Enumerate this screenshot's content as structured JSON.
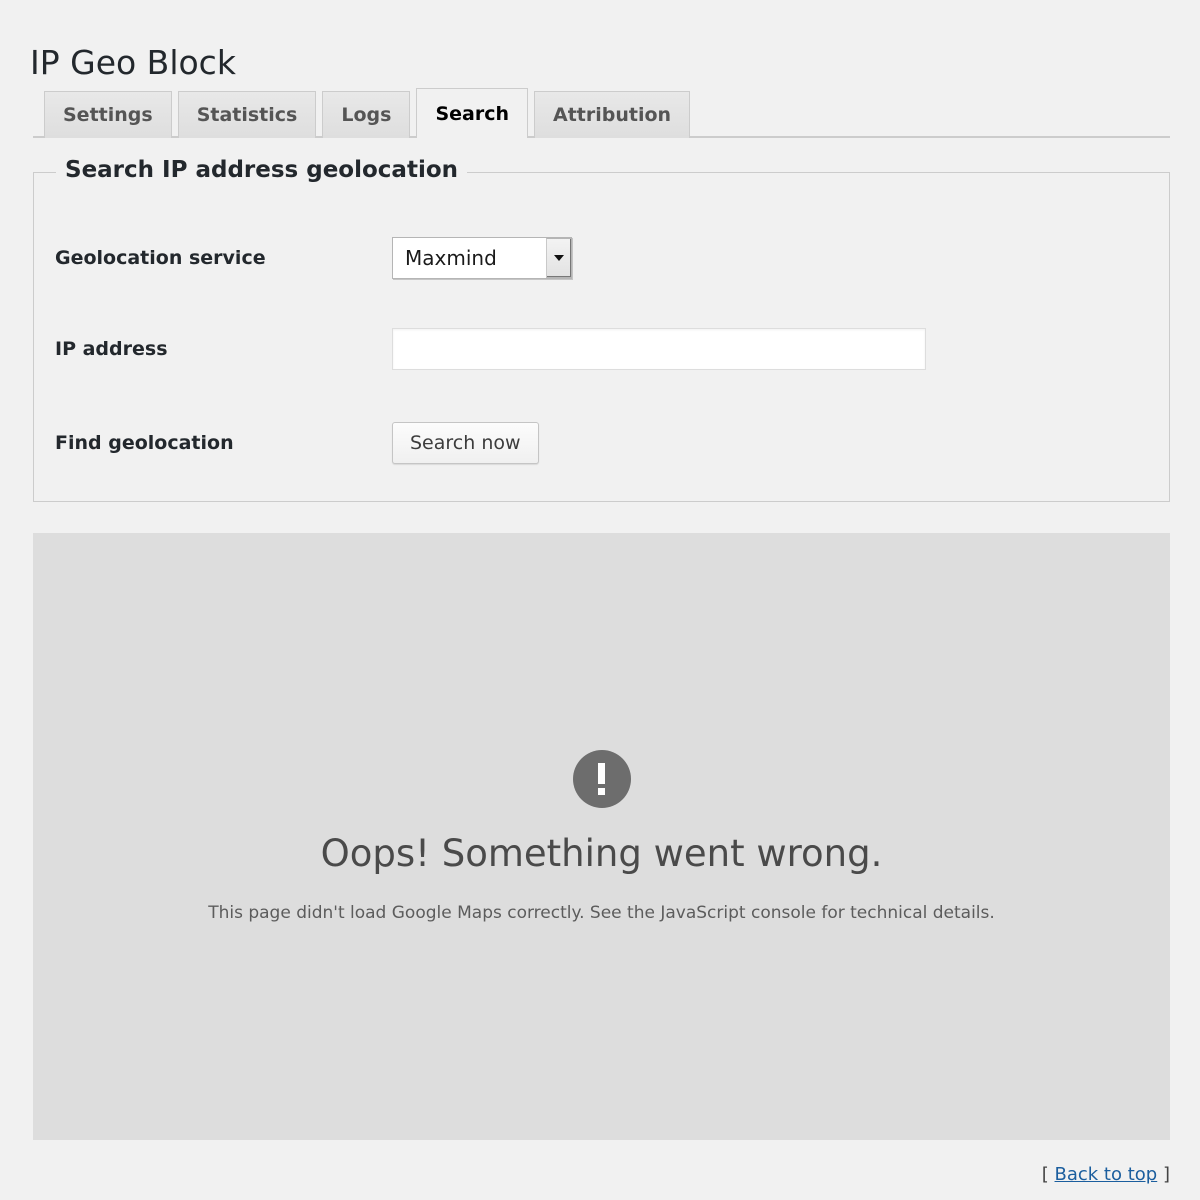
{
  "page": {
    "title": "IP Geo Block"
  },
  "tabs": [
    {
      "label": "Settings",
      "active": false,
      "name": "tab-settings"
    },
    {
      "label": "Statistics",
      "active": false,
      "name": "tab-statistics"
    },
    {
      "label": "Logs",
      "active": false,
      "name": "tab-logs"
    },
    {
      "label": "Search",
      "active": true,
      "name": "tab-search"
    },
    {
      "label": "Attribution",
      "active": false,
      "name": "tab-attribution"
    }
  ],
  "panel": {
    "legend": "Search IP address geolocation",
    "rows": {
      "service": {
        "label": "Geolocation service",
        "selected": "Maxmind",
        "options": [
          "Maxmind"
        ]
      },
      "ip": {
        "label": "IP address",
        "value": "",
        "placeholder": ""
      },
      "find": {
        "label": "Find geolocation",
        "button_label": "Search now"
      }
    }
  },
  "map": {
    "error_icon": "exclamation-icon",
    "error_title": "Oops! Something went wrong.",
    "error_description": "This page didn't load Google Maps correctly. See the JavaScript console for technical details."
  },
  "footer": {
    "open_bracket": "[",
    "link_label": "Back to top",
    "close_bracket": "]"
  },
  "colors": {
    "page_background": "#f1f1f1",
    "map_background": "#dddddd",
    "error_icon": "#6d6d6d",
    "link": "#1b5e9e",
    "title": "#23282d",
    "border": "#cccccc"
  }
}
